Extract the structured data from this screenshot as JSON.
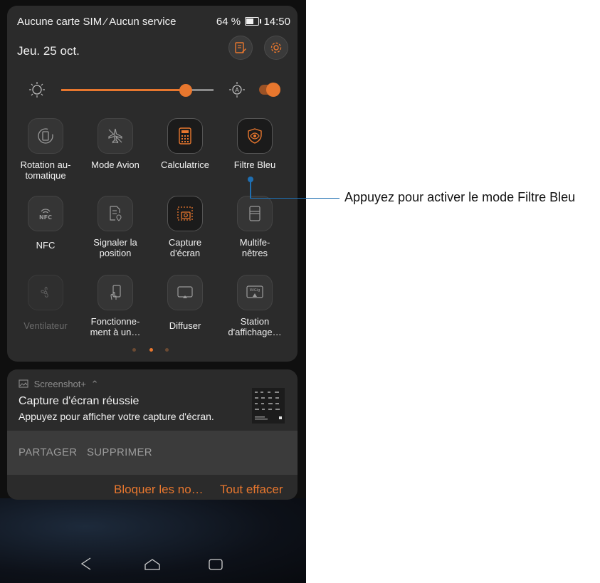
{
  "status_bar": {
    "carrier": "Aucune carte SIM ⁄ Aucun service",
    "battery": "64 %",
    "time": "14:50"
  },
  "header": {
    "date": "Jeu. 25 oct."
  },
  "brightness": {
    "level": 0.82,
    "auto_enabled": true
  },
  "tiles": [
    {
      "label": "Rotation au-\ntomatique",
      "icon": "auto-rotate-icon",
      "enabled": true
    },
    {
      "label": "Mode Avion",
      "icon": "airplane-icon",
      "enabled": true
    },
    {
      "label": "Calculatrice",
      "icon": "calculator-icon",
      "enabled": true
    },
    {
      "label": "Filtre Bleu",
      "icon": "eye-shield-icon",
      "enabled": true
    },
    {
      "label": "NFC",
      "icon": "nfc-icon",
      "enabled": true
    },
    {
      "label": "Signaler la\nposition",
      "icon": "location-report-icon",
      "enabled": true
    },
    {
      "label": "Capture\nd'écran",
      "icon": "screenshot-icon",
      "enabled": true
    },
    {
      "label": "Multife-\nnêtres",
      "icon": "multiwindow-icon",
      "enabled": true
    },
    {
      "label": "Ventilateur",
      "icon": "fan-icon",
      "enabled": false
    },
    {
      "label": "Fonctionne-\nment à un…",
      "icon": "one-hand-icon",
      "enabled": true
    },
    {
      "label": "Diffuser",
      "icon": "cast-icon",
      "enabled": true
    },
    {
      "label": "Station\nd'affichage…",
      "icon": "wigig-icon",
      "enabled": true
    }
  ],
  "pager": {
    "count": 3,
    "active": 1
  },
  "notification": {
    "app": "Screenshot+",
    "title": "Capture d'écran réussie",
    "body": "Appuyez pour afficher votre capture d'écran.",
    "actions": [
      "PARTAGER",
      "SUPPRIMER"
    ],
    "footer_block": "Bloquer les no…",
    "footer_clear": "Tout effacer"
  },
  "annotation": {
    "text": "Appuyez pour activer le mode Filtre Bleu"
  },
  "colors": {
    "accent": "#e8772e",
    "panel": "#2b2b2b",
    "callout": "#1f6fb2"
  }
}
